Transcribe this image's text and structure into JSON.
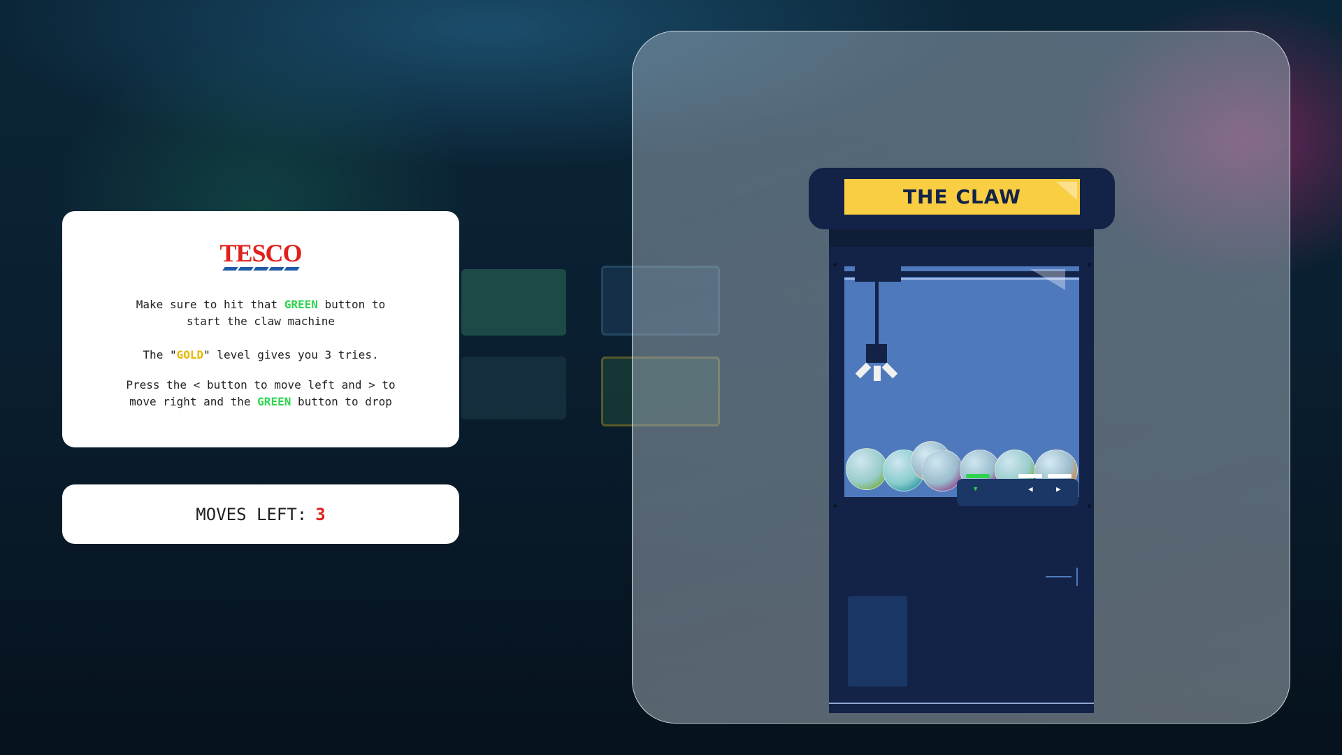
{
  "info_card": {
    "logo_text": "TESCO",
    "line1_pre": "Make sure to hit that ",
    "line1_green": "GREEN",
    "line1_post": " button to",
    "line2": "start the claw machine",
    "gold_pre": "The \"",
    "gold_word": "GOLD",
    "gold_post": "\" level gives you 3 tries.",
    "press_line1": "Press the < button to move left and > to",
    "press_line2_pre": "move right and the ",
    "press_line2_green": "GREEN",
    "press_line2_post": " button to drop"
  },
  "moves": {
    "label": "MOVES LEFT:",
    "value": "3"
  },
  "machine": {
    "title": "THE CLAW",
    "controls": {
      "drop": "▼",
      "left": "◀",
      "right": "▶"
    }
  },
  "colors": {
    "green": "#2ed44f",
    "gold": "#e7b800",
    "red": "#e0201b",
    "machine": "#132347",
    "sign": "#f9ce43"
  }
}
